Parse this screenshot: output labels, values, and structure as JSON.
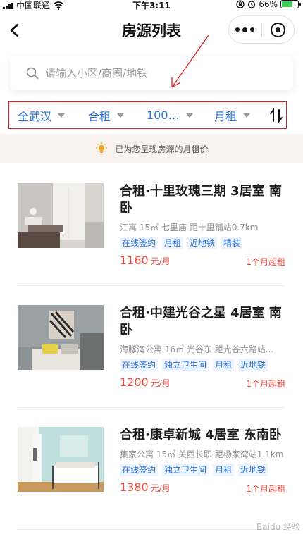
{
  "status_bar": {
    "carrier": "中国联通",
    "time": "下午3:11",
    "battery_percent": "66%",
    "battery_level": 0.66
  },
  "nav": {
    "title": "房源列表"
  },
  "search": {
    "placeholder": "请输入小区/商圈/地铁"
  },
  "filters": [
    {
      "label": "全武汉"
    },
    {
      "label": "合租"
    },
    {
      "label": "100…"
    },
    {
      "label": "月租"
    }
  ],
  "notice": {
    "text": "已为您呈现房源的月租价"
  },
  "listings": [
    {
      "title": "合租·十里玫瑰三期 3居室 南卧",
      "meta": "江寓 15㎡ 七里庙 距十里铺站0.7km",
      "tags": [
        "在线签约",
        "月租",
        "近地铁",
        "精装"
      ],
      "price": "1160",
      "unit": "元/月",
      "term": "1个月起租"
    },
    {
      "title": "合租·中建光谷之星 4居室 南卧",
      "meta": "海豚湾公寓 16㎡ 光谷东 距光谷六路站...",
      "tags": [
        "在线签约",
        "独立卫生间",
        "月租",
        "近地铁"
      ],
      "price": "1200",
      "unit": "元/月",
      "term": "1个月起租"
    },
    {
      "title": "合租·康卓新城 4居室 东南卧",
      "meta": "集家公寓 15㎡ 关西长职 距杨家湾站1.1km",
      "tags": [
        "在线签约",
        "独立卫生间",
        "月租",
        "近地铁"
      ],
      "price": "1380",
      "unit": "元/月",
      "term": "1个月起租"
    }
  ],
  "watermark": "Baidu 经验",
  "colors": {
    "accent_blue": "#2a6fd6",
    "price_red": "#f5483b",
    "highlight_red": "#e02020"
  }
}
